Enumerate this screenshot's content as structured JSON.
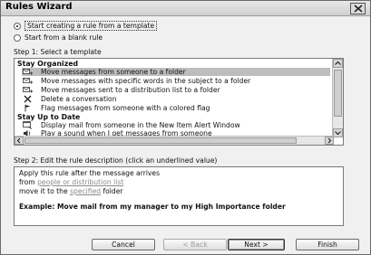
{
  "window": {
    "title": "Rules Wizard",
    "close_icon": "close-icon"
  },
  "options": {
    "from_template": "Start creating a rule from a template",
    "from_blank": "Start from a blank rule",
    "selected": "from_template"
  },
  "step1": {
    "label": "Step 1: Select a template",
    "groups": [
      {
        "heading": "Stay Organized",
        "items": [
          {
            "label": "Move messages from someone to a folder",
            "icon": "envelope-move-icon",
            "selected": true
          },
          {
            "label": "Move messages with specific words in the subject to a folder",
            "icon": "envelope-move-icon",
            "selected": false
          },
          {
            "label": "Move messages sent to a distribution list to a folder",
            "icon": "envelope-move-icon",
            "selected": false
          },
          {
            "label": "Delete a conversation",
            "icon": "delete-x-icon",
            "selected": false
          },
          {
            "label": "Flag messages from someone with a colored flag",
            "icon": "flag-icon",
            "selected": false
          }
        ]
      },
      {
        "heading": "Stay Up to Date",
        "items": [
          {
            "label": "Display mail from someone in the New Item Alert Window",
            "icon": "alert-window-icon",
            "selected": false
          },
          {
            "label": "Play a sound when I get messages from someone",
            "icon": "sound-icon",
            "selected": false
          }
        ]
      }
    ]
  },
  "step2": {
    "label": "Step 2: Edit the rule description (click an underlined value)",
    "line1": "Apply this rule after the message arrives",
    "line2_prefix": "from ",
    "line2_link": "people or distribution list",
    "line3_prefix": "move it to the ",
    "line3_link": "specified",
    "line3_suffix": " folder",
    "example": "Example: Move mail from my manager to my High Importance folder"
  },
  "buttons": {
    "cancel": "Cancel",
    "back": "< Back",
    "next": "Next >",
    "finish": "Finish"
  }
}
